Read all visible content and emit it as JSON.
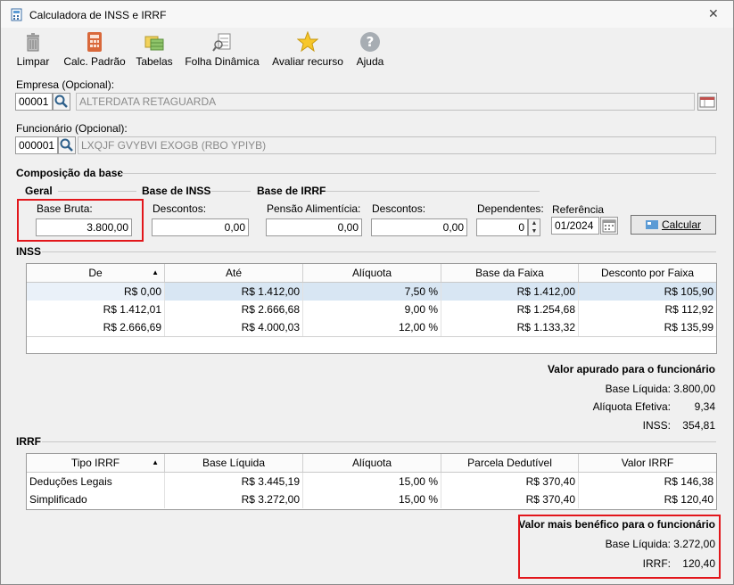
{
  "window": {
    "title": "Calculadora de INSS e IRRF",
    "close_glyph": "✕"
  },
  "toolbar": [
    {
      "label": "Limpar",
      "icon": "trash-icon"
    },
    {
      "label": "Calc. Padrão",
      "icon": "calculator-icon"
    },
    {
      "label": "Tabelas",
      "icon": "tables-icon"
    },
    {
      "label": "Folha Dinâmica",
      "icon": "dynamic-sheet-icon"
    },
    {
      "label": "Avaliar recurso",
      "icon": "star-icon"
    },
    {
      "label": "Ajuda",
      "icon": "help-icon"
    }
  ],
  "empresa": {
    "label": "Empresa (Opcional):",
    "code": "00001",
    "name": "ALTERDATA RETAGUARDA"
  },
  "funcionario": {
    "label": "Funcionário (Opcional):",
    "code": "000001",
    "name": "LXQJF GVYBVI EXOGB (RBO YPIYB)"
  },
  "composicao": {
    "title": "Composição da base",
    "geral": "Geral",
    "base_inss": "Base de INSS",
    "base_irrf": "Base de IRRF",
    "base_bruta_label": "Base Bruta:",
    "base_bruta": "3.800,00",
    "descontos_inss_label": "Descontos:",
    "descontos_inss": "0,00",
    "pensao_label": "Pensão Alimentícia:",
    "pensao": "0,00",
    "descontos_irrf_label": "Descontos:",
    "descontos_irrf": "0,00",
    "dependentes_label": "Dependentes:",
    "dependentes": "0",
    "referencia_label": "Referência",
    "referencia": "01/2024",
    "calcular": "Calcular"
  },
  "inss": {
    "title": "INSS",
    "columns": [
      "De",
      "Até",
      "Alíquota",
      "Base da Faixa",
      "Desconto por Faixa"
    ],
    "rows": [
      [
        "R$ 0,00",
        "R$ 1.412,00",
        "7,50 %",
        "R$ 1.412,00",
        "R$ 105,90"
      ],
      [
        "R$ 1.412,01",
        "R$ 2.666,68",
        "9,00 %",
        "R$ 1.254,68",
        "R$ 112,92"
      ],
      [
        "R$ 2.666,69",
        "R$ 4.000,03",
        "12,00 %",
        "R$ 1.133,32",
        "R$ 135,99"
      ]
    ],
    "summary_title": "Valor apurado para o funcionário",
    "base_liquida_label": "Base Líquida:",
    "base_liquida": "3.800,00",
    "aliquota_label": "Alíquota Efetiva:",
    "aliquota": "9,34",
    "inss_label": "INSS:",
    "inss": "354,81"
  },
  "irrf": {
    "title": "IRRF",
    "columns": [
      "Tipo IRRF",
      "Base Líquida",
      "Alíquota",
      "Parcela Dedutível",
      "Valor IRRF"
    ],
    "rows": [
      [
        "Deduções Legais",
        "R$ 3.445,19",
        "15,00 %",
        "R$ 370,40",
        "R$ 146,38"
      ],
      [
        "Simplificado",
        "R$ 3.272,00",
        "15,00 %",
        "R$ 370,40",
        "R$ 120,40"
      ]
    ],
    "summary_title": "Valor mais benéfico para o funcionário",
    "base_liquida_label": "Base Líquida:",
    "base_liquida": "3.272,00",
    "irrf_label": "IRRF:",
    "irrf": "120,40"
  },
  "colors": {
    "highlight_red": "#e2161b",
    "selected_row": "#d8e6f3"
  }
}
